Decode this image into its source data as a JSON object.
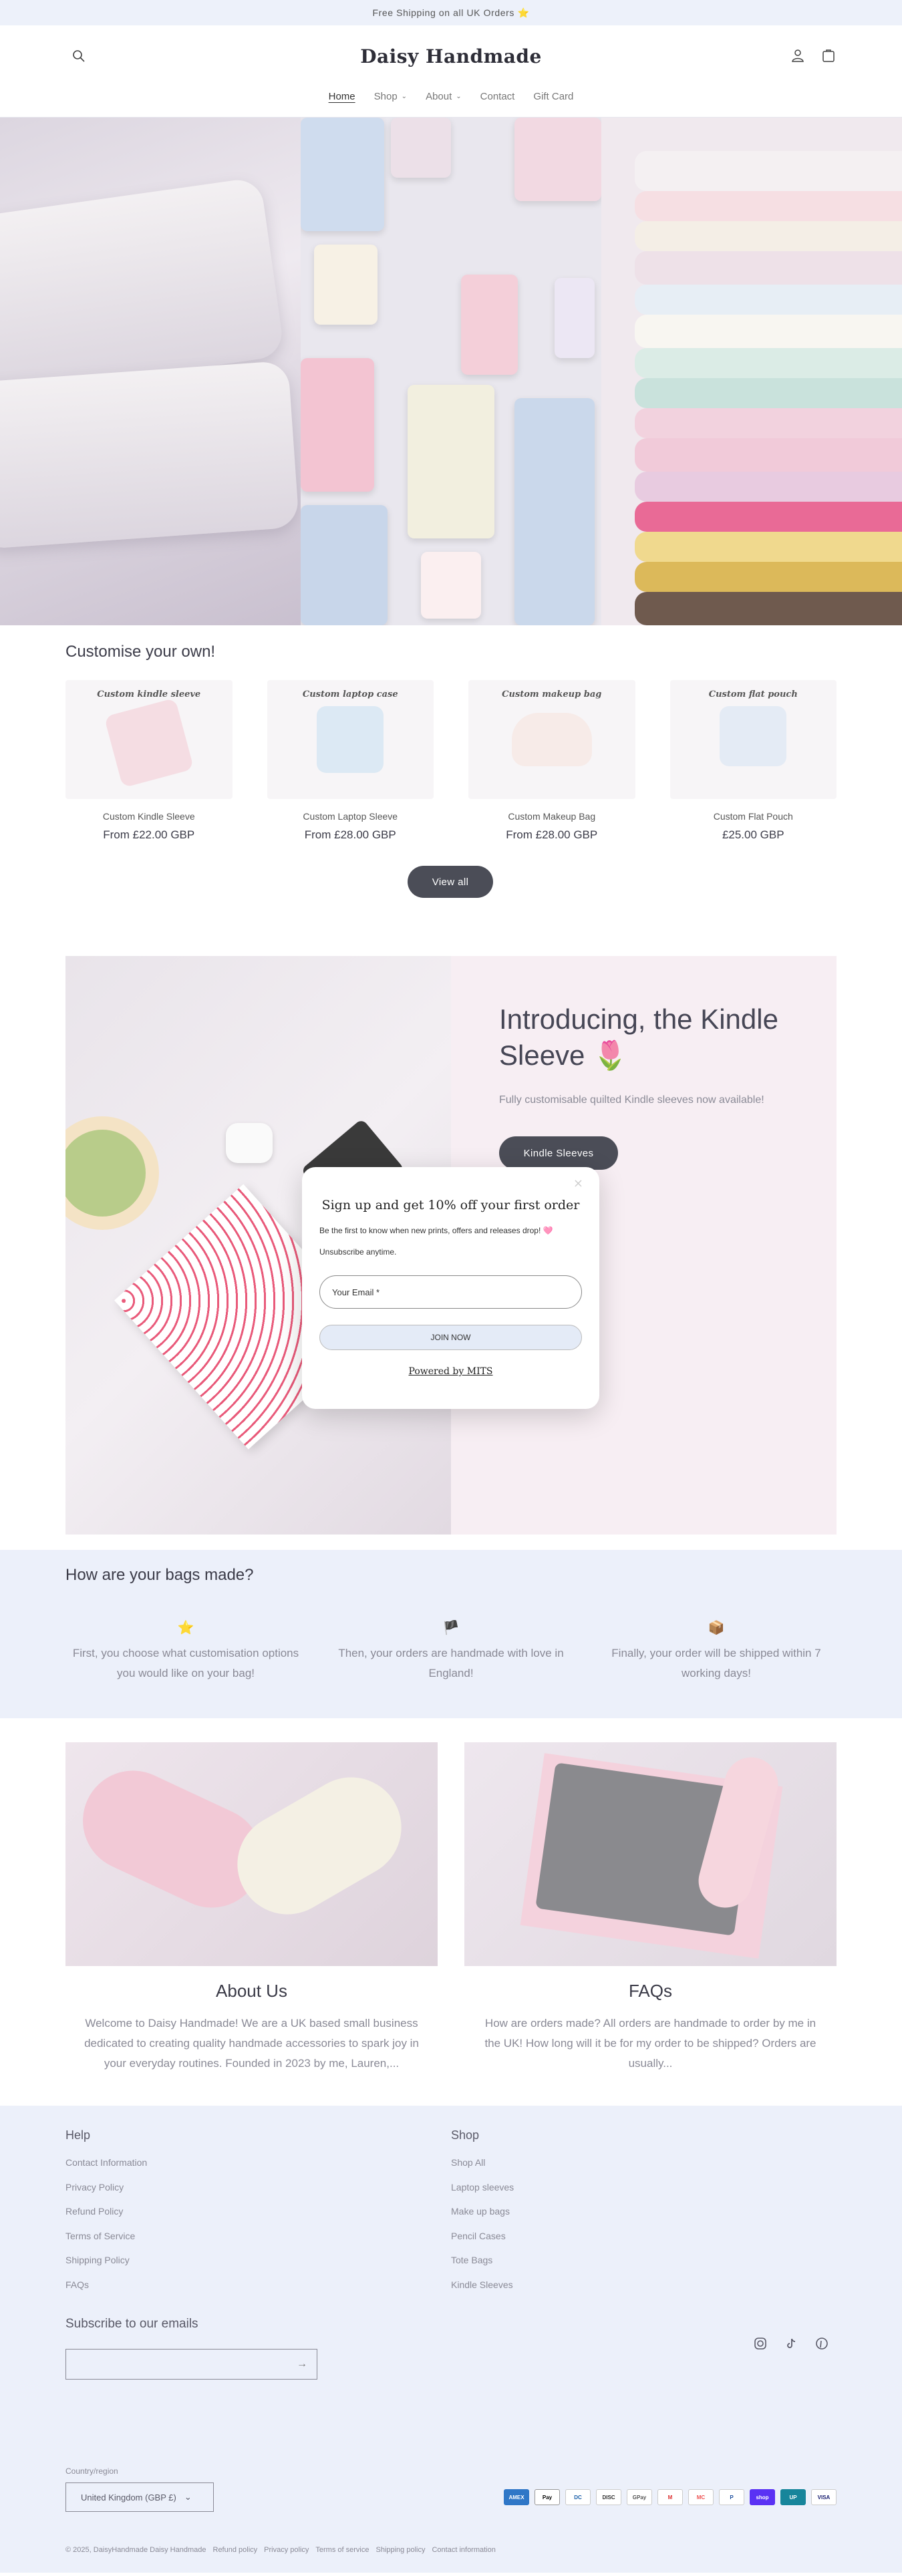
{
  "announcement": {
    "text": "Free Shipping on all UK Orders",
    "star": "⭐"
  },
  "header": {
    "logo": "Daisy Handmade",
    "nav": [
      {
        "label": "Home",
        "active": true
      },
      {
        "label": "Shop",
        "dropdown": true
      },
      {
        "label": "About",
        "dropdown": true
      },
      {
        "label": "Contact"
      },
      {
        "label": "Gift Card"
      }
    ]
  },
  "customise": {
    "title": "Customise your own!",
    "products": [
      {
        "img_label": "Custom kindle sleeve",
        "name": "Custom Kindle Sleeve",
        "price": "From £22.00 GBP"
      },
      {
        "img_label": "Custom laptop case",
        "name": "Custom Laptop Sleeve",
        "price": "From £28.00 GBP"
      },
      {
        "img_label": "Custom makeup bag",
        "name": "Custom Makeup Bag",
        "price": "From £28.00 GBP"
      },
      {
        "img_label": "Custom flat pouch",
        "name": "Custom Flat Pouch",
        "price": "£25.00 GBP"
      }
    ],
    "view_all": "View all"
  },
  "feature": {
    "title": "Introducing, the Kindle Sleeve 🌷",
    "subtitle": "Fully customisable quilted Kindle sleeves now available!",
    "button": "Kindle Sleeves"
  },
  "popup": {
    "title": "Sign up and get 10% off your first order",
    "line1": "Be the first to know when new prints, offers and releases drop! 🩷",
    "line2": "Unsubscribe anytime.",
    "email_placeholder": "Your Email *",
    "join": "JOIN NOW",
    "powered": "Powered by MITS",
    "close": "×"
  },
  "how": {
    "title": "How are your bags made?",
    "steps": [
      {
        "icon": "⭐",
        "text": "First, you choose what customisation options you would like on your bag!"
      },
      {
        "icon": "🏴",
        "text": "Then, your orders are handmade with love in England!"
      },
      {
        "icon": "📦",
        "text": "Finally, your order will be shipped within 7 working days!"
      }
    ]
  },
  "promo": [
    {
      "title": "About Us",
      "text": "Welcome to Daisy Handmade! We are a UK based small business dedicated to creating quality handmade accessories to spark joy in your everyday routines. Founded in 2023 by me, Lauren,..."
    },
    {
      "title": "FAQs",
      "text": "How are orders made? All orders are handmade to order by me in the UK!   How long will it be for my order to be shipped? Orders are usually..."
    }
  ],
  "footer": {
    "help_title": "Help",
    "help_links": [
      "Contact Information",
      "Privacy Policy",
      "Refund Policy",
      "Terms of Service",
      "Shipping Policy",
      "FAQs"
    ],
    "shop_title": "Shop",
    "shop_links": [
      "Shop All",
      "Laptop sleeves",
      "Make up bags",
      "Pencil Cases",
      "Tote Bags",
      "Kindle Sleeves"
    ],
    "subscribe_title": "Subscribe to our emails",
    "country_label": "Country/region",
    "country_value": "United Kingdom (GBP £)",
    "payments": [
      "AMEX",
      "Pay",
      "DC",
      "DISC",
      "GPay",
      "M",
      "MC",
      "P",
      "shop",
      "UP",
      "VISA"
    ],
    "copyright": "© 2025, DaisyHandmade Daisy Handmade",
    "policies": [
      "Refund policy",
      "Privacy policy",
      "Terms of service",
      "Shipping policy",
      "Contact information"
    ]
  }
}
